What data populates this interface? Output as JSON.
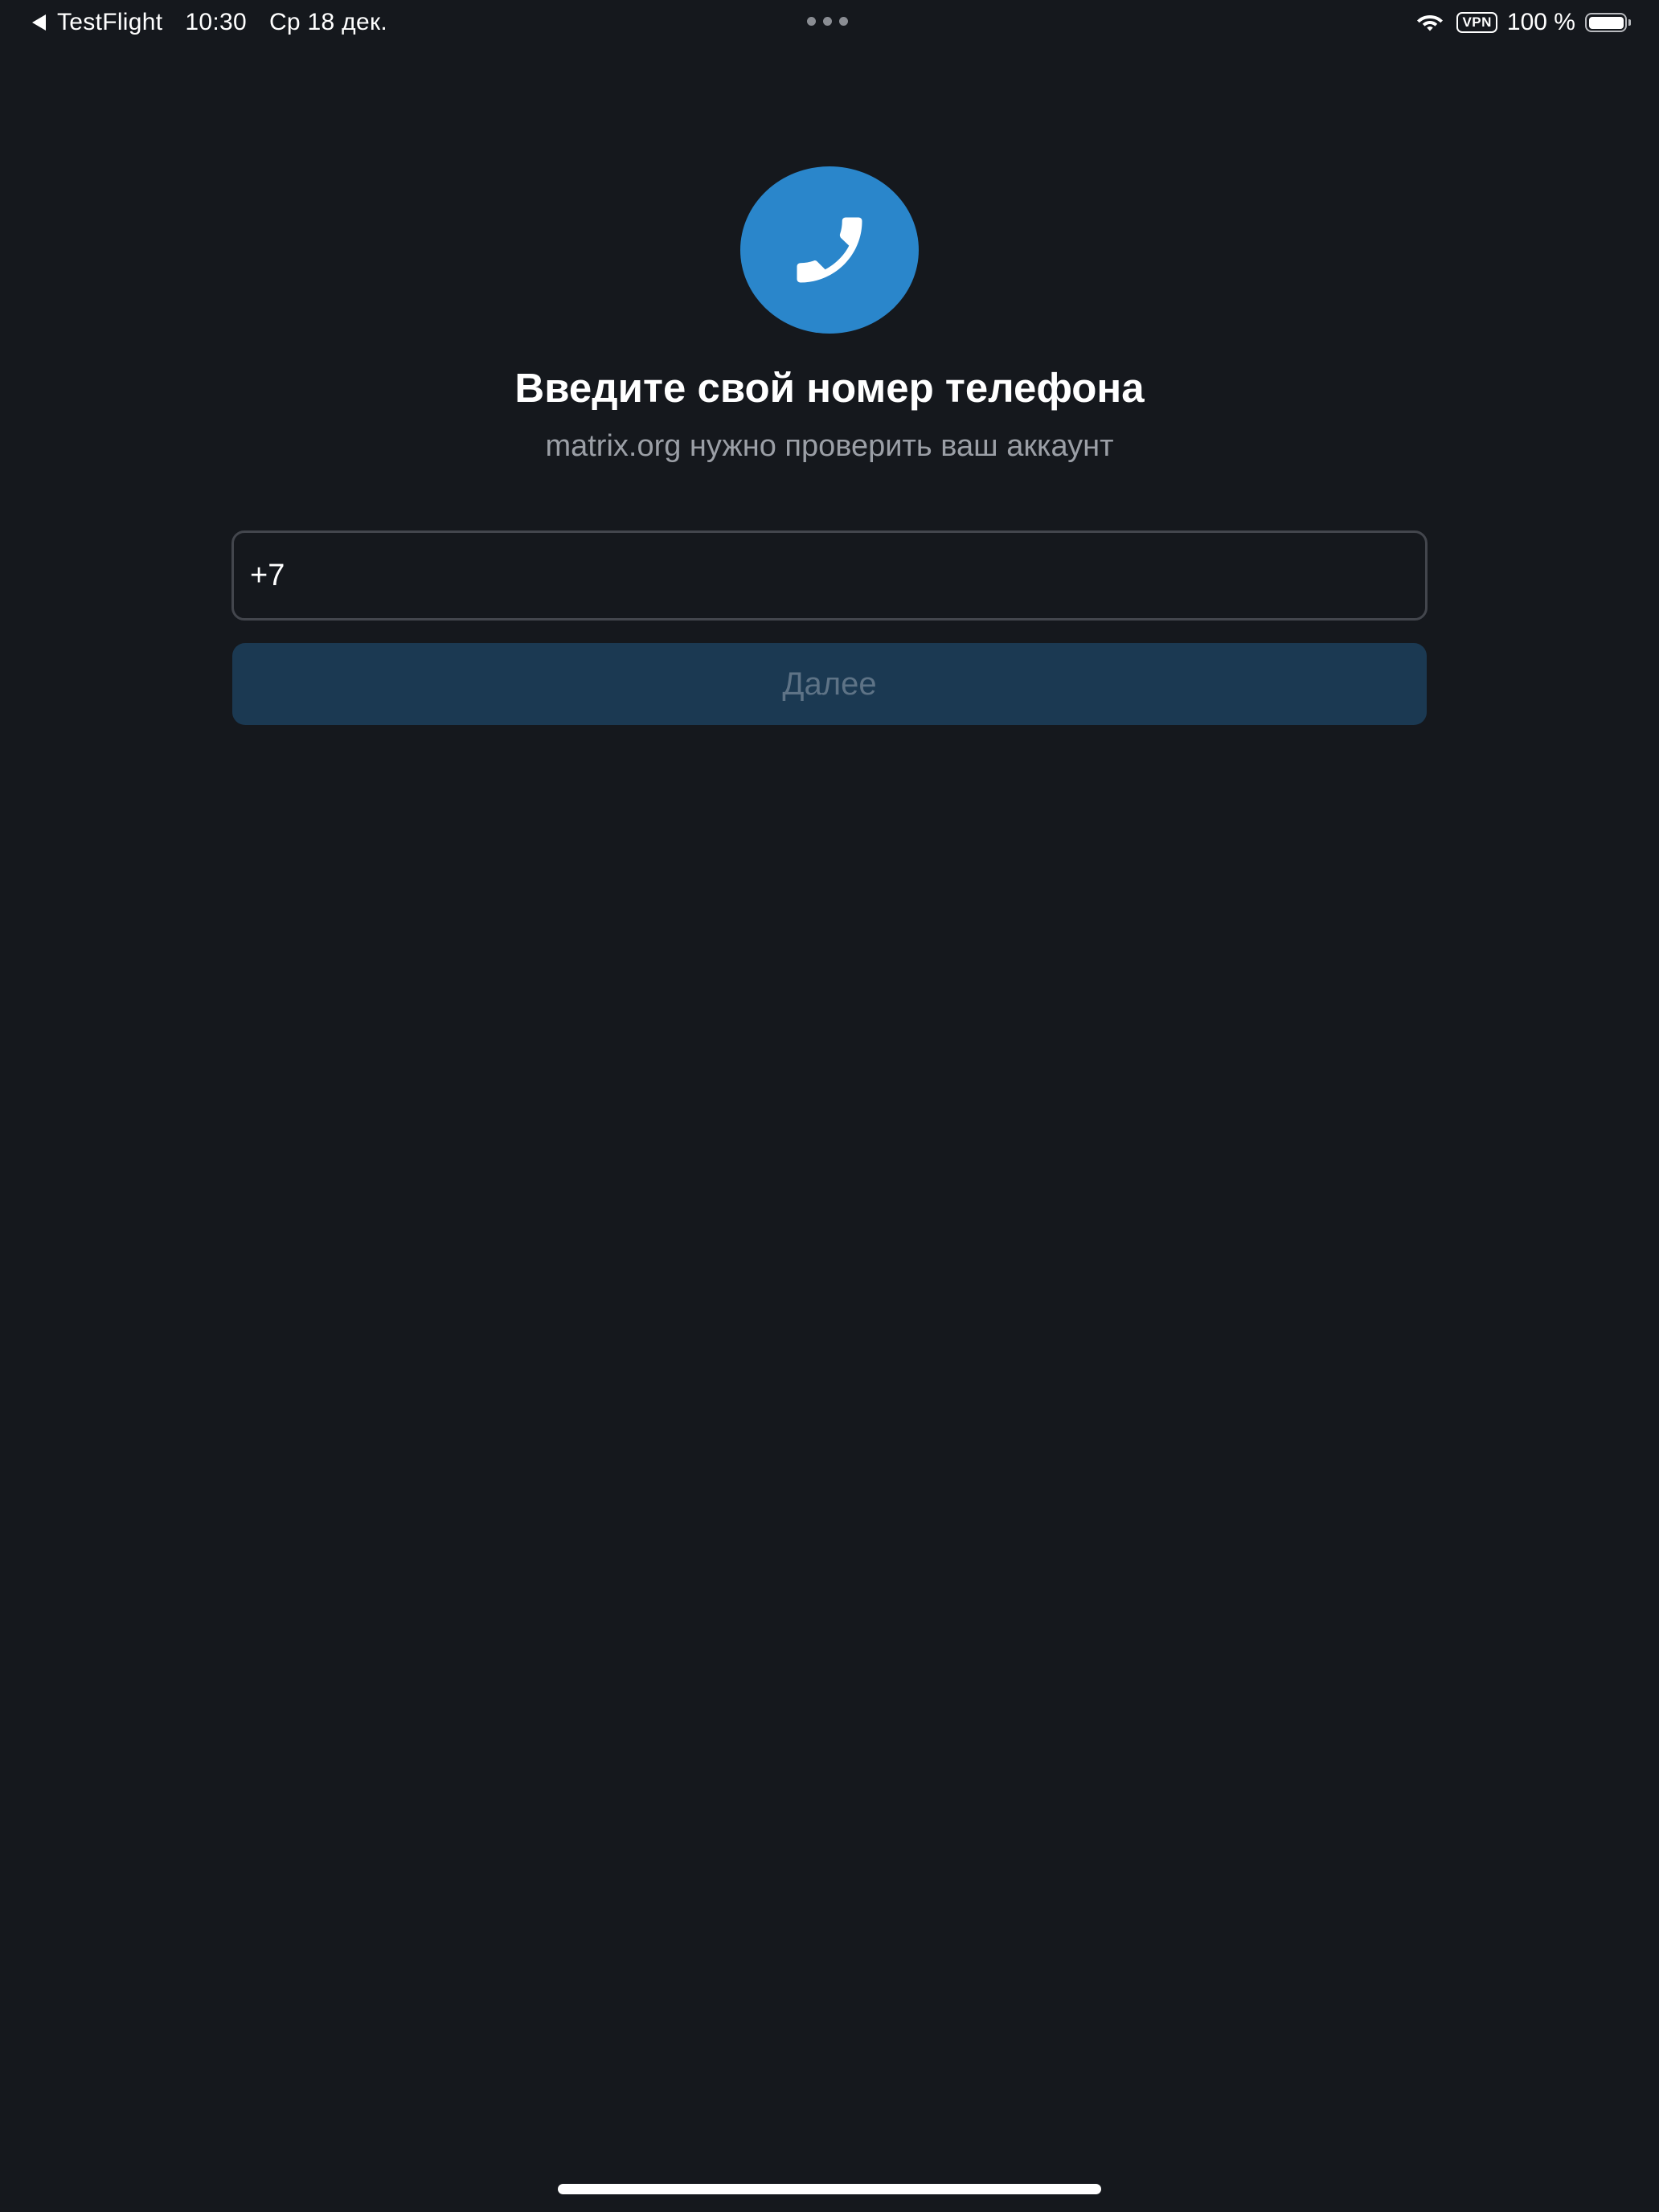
{
  "status_bar": {
    "back_app": "TestFlight",
    "time": "10:30",
    "date": "Ср 18 дек.",
    "vpn": "VPN",
    "battery": "100 %",
    "battery_level": 1.0
  },
  "main": {
    "icon": "phone-icon",
    "title": "Введите свой номер телефона",
    "subtitle": "matrix.org нужно проверить ваш аккаунт",
    "phone_input_value": "+7",
    "next_button_label": "Далее"
  },
  "colors": {
    "background": "#15181d",
    "accent": "#2a86cb",
    "button_disabled_bg": "#1b3952",
    "button_disabled_text": "#5e7386",
    "subtitle_text": "#9b9fa6"
  }
}
